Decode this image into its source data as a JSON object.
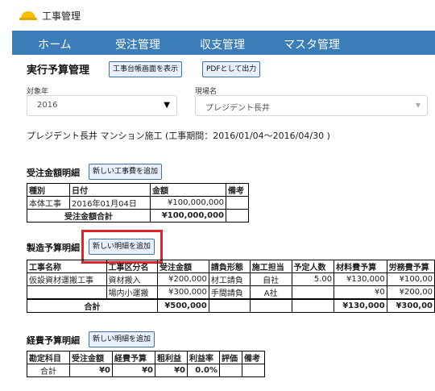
{
  "app": {
    "title": "工事管理"
  },
  "nav": {
    "items": [
      "ホーム",
      "受注管理",
      "収支管理",
      "マスタ管理"
    ]
  },
  "page": {
    "title": "実行予算管理",
    "btn_ledger": "工事台帳画面を表示",
    "btn_pdf": "PDFとして出力"
  },
  "filters": {
    "year_label": "対象年",
    "year_value": "2016",
    "site_label": "現場名",
    "site_value": "プレジデント長井"
  },
  "project_info": "プレジデント長井 マンション施工 (工事期間：2016/01/04〜2016/04/30 )",
  "orders": {
    "title": "受注金額明細",
    "add_button": "新しい工事費を追加",
    "headers": [
      "種別",
      "日付",
      "金額",
      "備考"
    ],
    "row": {
      "type": "本体工事",
      "date": "2016年01月04日",
      "amount": "¥100,000,000",
      "note": ""
    },
    "total_label": "受注金額合計",
    "total_value": "¥100,000,000"
  },
  "manufacturing": {
    "title": "製造予算明細",
    "add_button": "新しい明細を追加",
    "headers": [
      "工事名称",
      "工事区分名",
      "受注金額",
      "請負形態",
      "施工担当",
      "予定人数",
      "材料費予算",
      "労務費予算"
    ],
    "rows": [
      {
        "name": "仮設資材運搬工事",
        "division": "資材搬入",
        "amount": "¥200,000",
        "form": "材工請負",
        "staff": "自社",
        "people": "5.00",
        "material": "¥130,000",
        "labor": "¥100,00"
      },
      {
        "name": "",
        "division": "場内小運搬",
        "amount": "¥300,000",
        "form": "手間請負",
        "staff": "A社",
        "people": "",
        "material": "¥0",
        "labor": "¥200,00"
      }
    ],
    "total_label": "合計",
    "total_amount": "¥500,000",
    "total_material": "¥130,000",
    "total_labor": "¥300,00"
  },
  "expenses": {
    "title": "経費予算明細",
    "add_button": "新しい明細を追加",
    "headers": [
      "勘定科目",
      "受注金額",
      "経費予算",
      "粗利益",
      "利益率",
      "評価",
      "備考"
    ],
    "total_label": "合計",
    "totals": [
      "¥0",
      "¥0",
      "¥0",
      "0.0%"
    ]
  },
  "colors": {
    "nav_bg": "#3a7db8",
    "highlight": "#e0242a",
    "button_bg": "#e8f0ff"
  }
}
